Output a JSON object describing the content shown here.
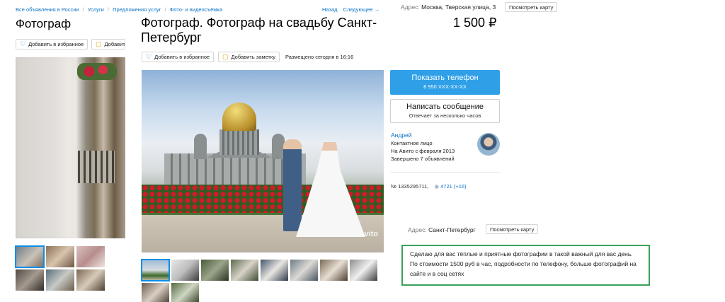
{
  "breadcrumbs": [
    "Все объявления в России",
    "Услуги",
    "Предложения услуг",
    "Фото- и видеосъёмка"
  ],
  "nav": {
    "back": "Назад",
    "next": "Следующее →"
  },
  "address_top": {
    "label": "Адрес:",
    "value": "Москва, Тверская улица, 3",
    "map_button": "Посмотреть карту"
  },
  "left_listing": {
    "title": "Фотограф",
    "favorite_label": "Добавить в избранное",
    "note_label": "Добавить"
  },
  "listing": {
    "title": "Фотограф. Фотограф на свадьбу Санкт-Петербург",
    "price": "1 500 ₽",
    "favorite_label": "Добавить в избранное",
    "note_label": "Добавить заметку",
    "posted": "Размещено сегодня в 16:16",
    "watermark": "Avito"
  },
  "contact": {
    "phone_button": "Показать телефон",
    "phone_masked": "8 950 XXX-XX-XX",
    "message_button": "Написать сообщение",
    "message_sub": "Отвечает за несколько часов"
  },
  "seller": {
    "name": "Андрей",
    "type": "Контактное лицо",
    "since": "На Авито с февраля 2013",
    "completed": "Завершено 7 объявлений"
  },
  "meta": {
    "number": "№ 1335295711,",
    "views": "4721 (+16)"
  },
  "address_bottom": {
    "label": "Адрес:",
    "value": "Санкт-Петербург",
    "map_button": "Посмотреть карту"
  },
  "description": "Сделаю для вас тёплые и приятные фотографии в такой важный для вас день. По стоимости 1500 руб в час, подробности по телефону, больше фотографий на сайте и в соц сетях",
  "icons": {
    "favorite": "heart-icon",
    "note": "note-icon",
    "views": "eye-icon"
  },
  "colors": {
    "link": "#0a72c6",
    "phone_button": "#2fa0e8",
    "highlight_border": "#3aa35a"
  }
}
